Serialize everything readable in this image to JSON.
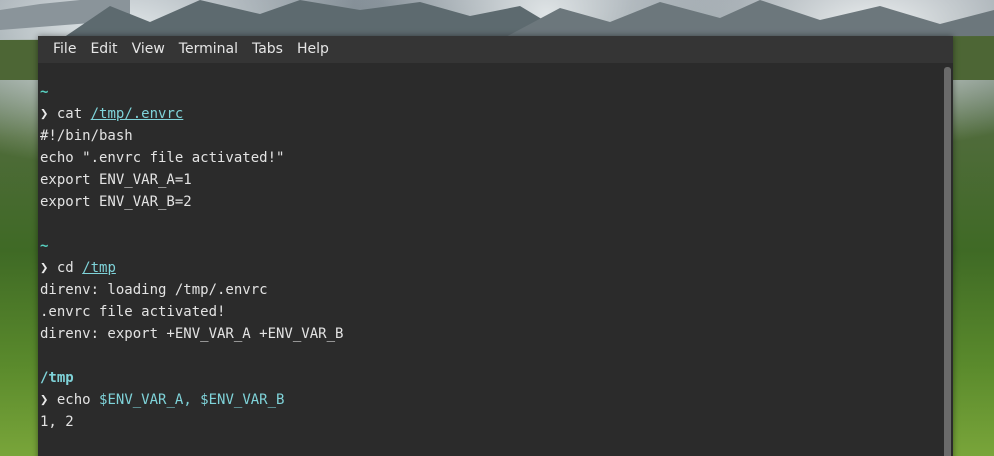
{
  "menubar": {
    "items": [
      "File",
      "Edit",
      "View",
      "Terminal",
      "Tabs",
      "Help"
    ]
  },
  "terminal": {
    "block1": {
      "dir": "~",
      "prompt": "❯",
      "command": "cat",
      "arg": "/tmp/.envrc",
      "output": [
        "#!/bin/bash",
        "echo \".envrc file activated!\"",
        "export ENV_VAR_A=1",
        "export ENV_VAR_B=2"
      ]
    },
    "block2": {
      "dir": "~",
      "prompt": "❯",
      "command": "cd",
      "arg": "/tmp",
      "output": [
        "direnv: loading /tmp/.envrc",
        ".envrc file activated!",
        "direnv: export +ENV_VAR_A +ENV_VAR_B"
      ]
    },
    "block3": {
      "dir": "/tmp",
      "prompt": "❯",
      "command": "echo",
      "arg": "$ENV_VAR_A, $ENV_VAR_B",
      "output": [
        "1, 2"
      ]
    }
  },
  "colors": {
    "background": "#2b2b2b",
    "menubar": "#353535",
    "accent": "#7fd3d9"
  }
}
